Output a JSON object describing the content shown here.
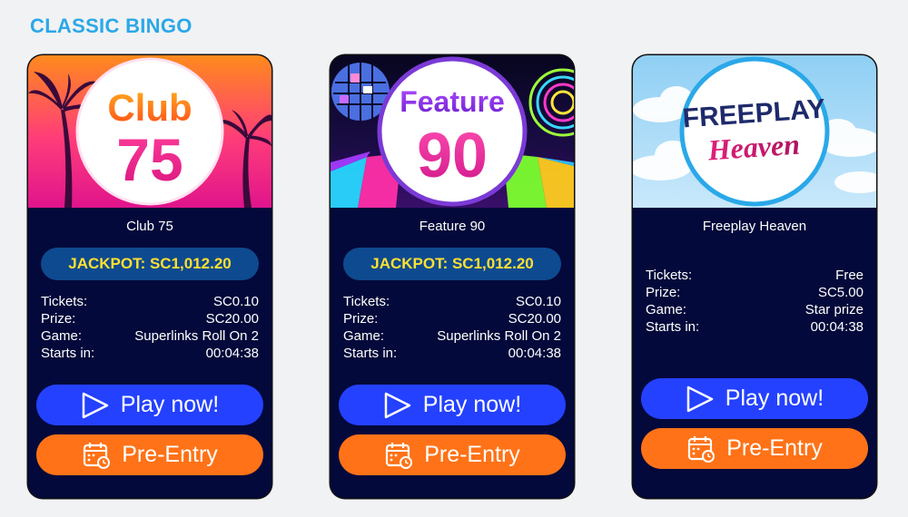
{
  "section_title": "CLASSIC BINGO",
  "colors": {
    "title": "#2aa8e8",
    "card_bg": "#03093a",
    "jackpot_bg": "#0e4a8f",
    "jackpot_text": "#ffe031",
    "play": "#2441ff",
    "pre_entry": "#ff7217"
  },
  "cards": [
    {
      "logo_line1": "Club",
      "logo_line2": "75",
      "name": "Club 75",
      "jackpot": "JACKPOT:  SC1,012.20",
      "details": [
        {
          "label": "Tickets:",
          "value": "SC0.10"
        },
        {
          "label": "Prize:",
          "value": "SC20.00"
        },
        {
          "label": "Game:",
          "value": "Superlinks Roll On 2"
        },
        {
          "label": "Starts in:",
          "value": "00:04:38"
        }
      ],
      "play_label": "Play now!",
      "pre_label": "Pre-Entry"
    },
    {
      "logo_line1": "Feature",
      "logo_line2": "90",
      "name": "Feature 90",
      "jackpot": "JACKPOT:  SC1,012.20",
      "details": [
        {
          "label": "Tickets:",
          "value": "SC0.10"
        },
        {
          "label": "Prize:",
          "value": "SC20.00"
        },
        {
          "label": "Game:",
          "value": "Superlinks Roll On 2"
        },
        {
          "label": "Starts in:",
          "value": "00:04:38"
        }
      ],
      "play_label": "Play now!",
      "pre_label": "Pre-Entry"
    },
    {
      "logo_line1": "FREEPLAY",
      "logo_line2": "Heaven",
      "name": "Freeplay Heaven",
      "details": [
        {
          "label": "Tickets:",
          "value": "Free"
        },
        {
          "label": "Prize:",
          "value": "SC5.00"
        },
        {
          "label": "Game:",
          "value": "Star prize"
        },
        {
          "label": "Starts in:",
          "value": "00:04:38"
        }
      ],
      "play_label": "Play now!",
      "pre_label": "Pre-Entry"
    }
  ]
}
